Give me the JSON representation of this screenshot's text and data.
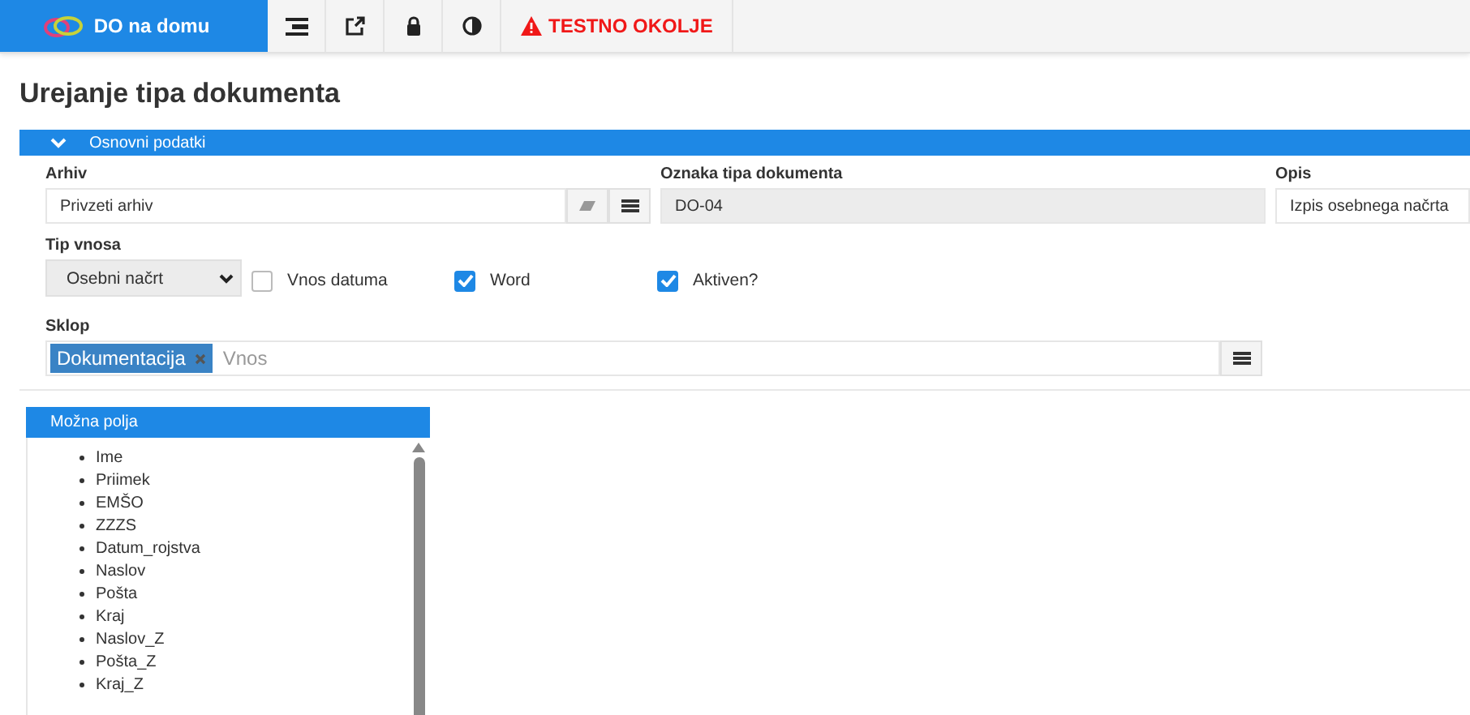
{
  "topbar": {
    "brand": "DO na domu",
    "warning": "TESTNO OKOLJE"
  },
  "page_title": "Urejanje tipa dokumenta",
  "section": {
    "title": "Osnovni podatki",
    "expanded": true
  },
  "fields": {
    "arhiv": {
      "label": "Arhiv",
      "value": "Privzeti arhiv"
    },
    "oznaka": {
      "label": "Oznaka tipa dokumenta",
      "value": "DO-04"
    },
    "opis": {
      "label": "Opis",
      "value": "Izpis osebnega načrta"
    },
    "tip": {
      "label": "Tip vnosa",
      "value": "Osebni načrt"
    },
    "checkboxes": [
      {
        "label": "Vnos datuma",
        "checked": false
      },
      {
        "label": "Word",
        "checked": true
      },
      {
        "label": "Aktiven?",
        "checked": true
      }
    ],
    "sklop": {
      "label": "Sklop",
      "tags": [
        "Dokumentacija"
      ],
      "placeholder": "Vnos"
    }
  },
  "possible_fields": {
    "title": "Možna polja",
    "items": [
      "Ime",
      "Priimek",
      "EMŠO",
      "ZZZS",
      "Datum_rojstva",
      "Naslov",
      "Pošta",
      "Kraj",
      "Naslov_Z",
      "Pošta_Z",
      "Kraj_Z"
    ]
  }
}
